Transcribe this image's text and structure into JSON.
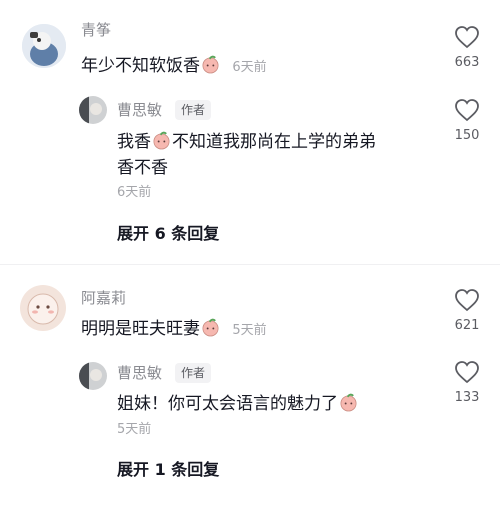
{
  "comments": [
    {
      "user": "青筝",
      "text_before": "年少不知软饭香",
      "time": "6天前",
      "likes": "663",
      "reply": {
        "user": "曹思敏",
        "badge": "作者",
        "text_line1_a": "我香",
        "text_line1_b": "不知道我那尚在上学的弟弟",
        "text_line2": "香不香",
        "time": "6天前",
        "likes": "150"
      },
      "expand_label": "展开 6 条回复"
    },
    {
      "user": "阿嘉莉",
      "text_before": "明明是旺夫旺妻",
      "time": "5天前",
      "likes": "621",
      "reply": {
        "user": "曹思敏",
        "badge": "作者",
        "text": "姐妹！你可太会语言的魅力了",
        "time": "5天前",
        "likes": "133"
      },
      "expand_label": "展开 1 条回复"
    }
  ],
  "colors": {
    "text": "#161823",
    "secondary": "#8a8b91",
    "peach": "#f3a6a0"
  },
  "icons": {
    "like": "heart-outline-icon",
    "emoji": "peach-emoji-icon"
  }
}
